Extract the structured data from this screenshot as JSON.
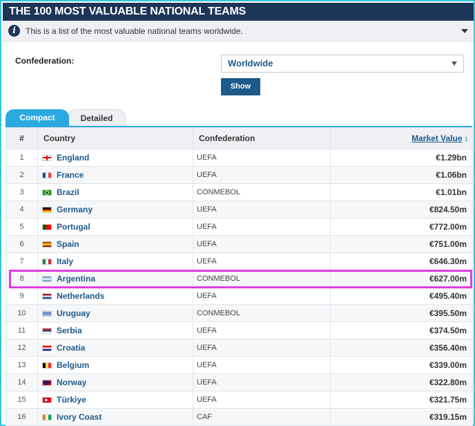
{
  "header": {
    "title": "THE 100 MOST VALUABLE NATIONAL TEAMS",
    "info_text": "This is a list of the most valuable national teams worldwide."
  },
  "filter": {
    "label": "Confederation:",
    "selected": "Worldwide",
    "button_label": "Show"
  },
  "tabs": [
    {
      "label": "Compact",
      "active": true
    },
    {
      "label": "Detailed",
      "active": false
    }
  ],
  "table": {
    "headers": {
      "rank": "#",
      "country": "Country",
      "confederation": "Confederation",
      "market_value": "Market Value"
    },
    "rows": [
      {
        "rank": "1",
        "country": "England",
        "flag": "england-flag",
        "confederation": "UEFA",
        "value": "€1.29bn"
      },
      {
        "rank": "2",
        "country": "France",
        "flag": "france-flag",
        "confederation": "UEFA",
        "value": "€1.06bn"
      },
      {
        "rank": "3",
        "country": "Brazil",
        "flag": "brazil-flag",
        "confederation": "CONMEBOL",
        "value": "€1.01bn"
      },
      {
        "rank": "4",
        "country": "Germany",
        "flag": "germany-flag",
        "confederation": "UEFA",
        "value": "€824.50m"
      },
      {
        "rank": "5",
        "country": "Portugal",
        "flag": "portugal-flag",
        "confederation": "UEFA",
        "value": "€772.00m"
      },
      {
        "rank": "6",
        "country": "Spain",
        "flag": "spain-flag",
        "confederation": "UEFA",
        "value": "€751.00m"
      },
      {
        "rank": "7",
        "country": "Italy",
        "flag": "italy-flag",
        "confederation": "UEFA",
        "value": "€646.30m"
      },
      {
        "rank": "8",
        "country": "Argentina",
        "flag": "argentina-flag",
        "confederation": "CONMEBOL",
        "value": "€627.00m"
      },
      {
        "rank": "9",
        "country": "Netherlands",
        "flag": "netherlands-flag",
        "confederation": "UEFA",
        "value": "€495.40m"
      },
      {
        "rank": "10",
        "country": "Uruguay",
        "flag": "uruguay-flag",
        "confederation": "CONMEBOL",
        "value": "€395.50m"
      },
      {
        "rank": "11",
        "country": "Serbia",
        "flag": "serbia-flag",
        "confederation": "UEFA",
        "value": "€374.50m"
      },
      {
        "rank": "12",
        "country": "Croatia",
        "flag": "croatia-flag",
        "confederation": "UEFA",
        "value": "€356.40m"
      },
      {
        "rank": "13",
        "country": "Belgium",
        "flag": "belgium-flag",
        "confederation": "UEFA",
        "value": "€339.00m"
      },
      {
        "rank": "14",
        "country": "Norway",
        "flag": "norway-flag",
        "confederation": "UEFA",
        "value": "€322.80m"
      },
      {
        "rank": "15",
        "country": "Türkiye",
        "flag": "turkiye-flag",
        "confederation": "UEFA",
        "value": "€321.75m"
      },
      {
        "rank": "16",
        "country": "Ivory Coast",
        "flag": "ivory-coast-flag",
        "confederation": "CAF",
        "value": "€319.15m"
      }
    ]
  },
  "colors": {
    "header_bg": "#1d3557",
    "accent_blue": "#2aa8e0",
    "link_blue": "#1d5a8a",
    "highlight": "#e03ce0",
    "frame": "#35c6d8"
  }
}
